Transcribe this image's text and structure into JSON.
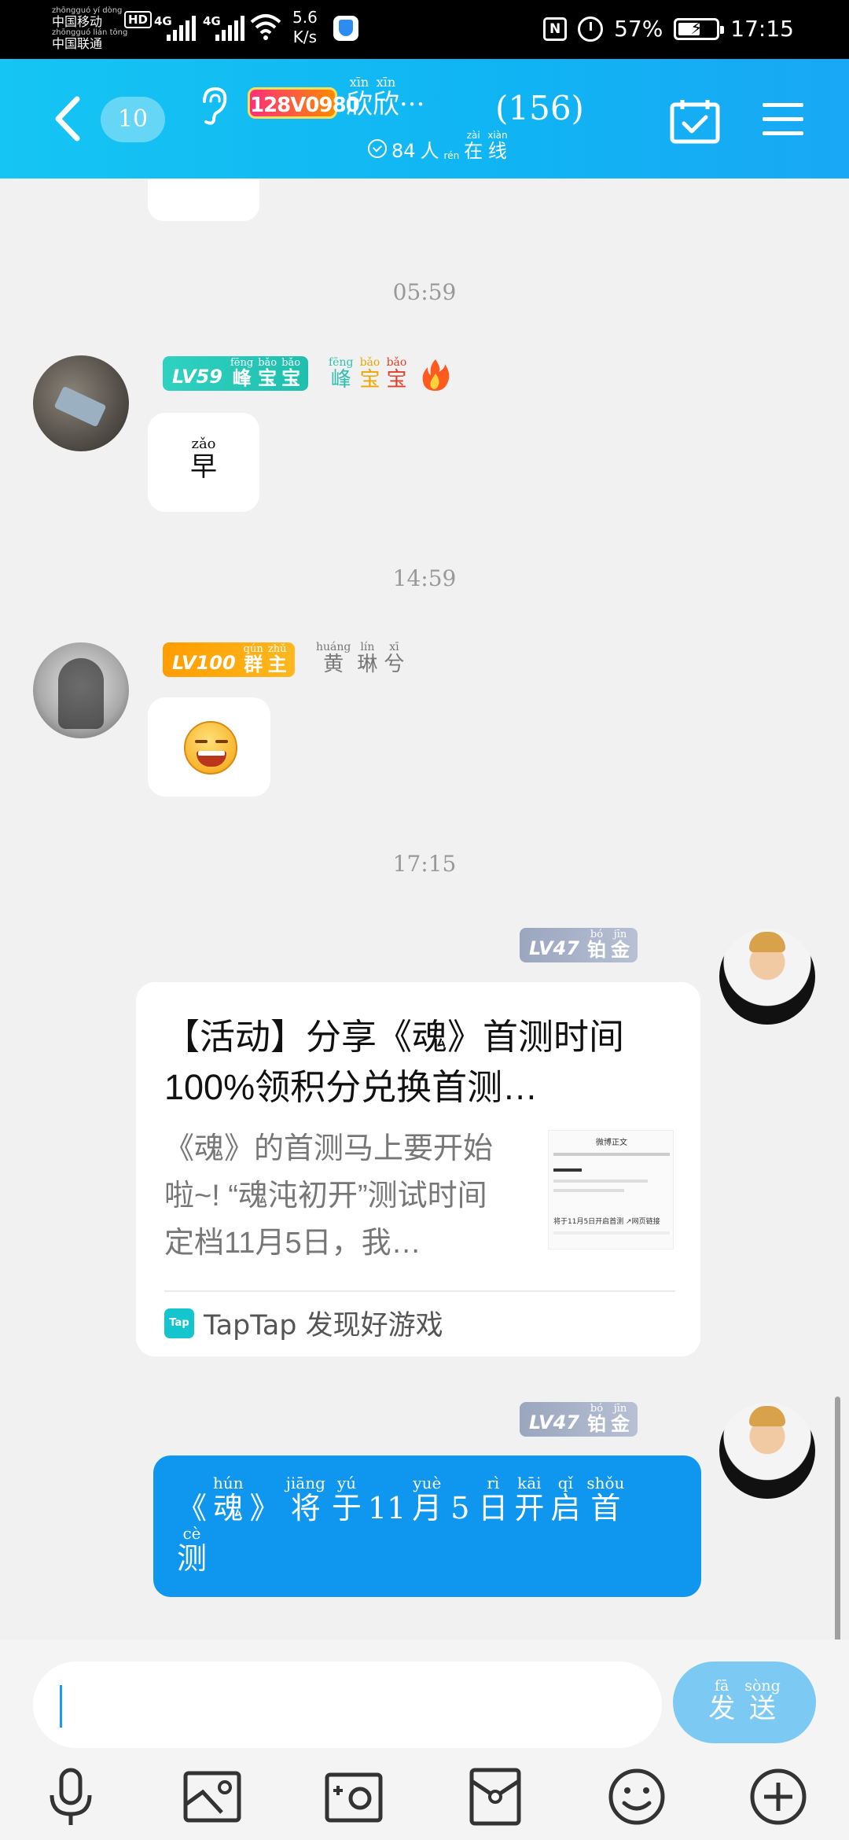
{
  "status_bar": {
    "carrier_1_pinyin": "zhōngguó yí dòng",
    "carrier_1": "中国移动",
    "carrier_2_pinyin": "zhōngguó lián tōng",
    "carrier_2": "中国联通",
    "hd": "HD",
    "network_1": "4G",
    "network_2": "4G",
    "speed_value": "5.6",
    "speed_unit": "K/s",
    "nfc": "N",
    "battery_percent": "57%",
    "battery_level": 0.57,
    "time": "17:15"
  },
  "header": {
    "unread_count": "10",
    "group_logo": "128V0980",
    "group_name": [
      {
        "py": "xīn",
        "hz": "欣"
      },
      {
        "py": "xīn",
        "hz": "欣"
      },
      {
        "py": "",
        "hz": "···"
      }
    ],
    "member_count": "(156)",
    "online_count": "84",
    "online_text": [
      {
        "py": "",
        "hz": "人"
      },
      {
        "py": "rén",
        "hz": ""
      },
      {
        "py": "zài",
        "hz": "在"
      },
      {
        "py": "xiàn",
        "hz": "线"
      }
    ]
  },
  "messages": {
    "ts1": "05:59",
    "ts2": "14:59",
    "ts3": "17:15",
    "m1": {
      "level": "LV59",
      "rank": [
        {
          "py": "fēng",
          "hz": "峰"
        },
        {
          "py": "bǎo",
          "hz": "宝"
        },
        {
          "py": "bǎo",
          "hz": "宝"
        }
      ],
      "nick": [
        {
          "py": "fēng",
          "hz": "峰"
        },
        {
          "py": "bǎo",
          "hz": "宝"
        },
        {
          "py": "bǎo",
          "hz": "宝"
        }
      ],
      "text_py": "zǎo",
      "text": "早"
    },
    "m2": {
      "level": "LV100",
      "rank": [
        {
          "py": "qún",
          "hz": "群"
        },
        {
          "py": "zhǔ",
          "hz": "主"
        }
      ],
      "nick": [
        {
          "py": "huáng",
          "hz": "黄"
        },
        {
          "py": "lín",
          "hz": "琳"
        },
        {
          "py": "xī",
          "hz": "兮"
        }
      ]
    },
    "m3": {
      "level": "LV47",
      "rank": [
        {
          "py": "bó",
          "hz": "铂"
        },
        {
          "py": "jīn",
          "hz": "金"
        }
      ],
      "card_title": "【活动】分享《魂》首测时间 100%领积分兑换首测…",
      "card_desc": "《魂》的首测马上要开始啦~! “魂沌初开”测试时间定档11月5日，我…",
      "thumb_title": "微博正文",
      "thumb_text": "将于11月5日开启首测 ↗网页链接",
      "source_logo": "Tap",
      "source": "TapTap 发现好游戏"
    },
    "m4": {
      "level": "LV47",
      "rank": [
        {
          "py": "bó",
          "hz": "铂"
        },
        {
          "py": "jīn",
          "hz": "金"
        }
      ],
      "line1": [
        {
          "py": "",
          "hz": "《"
        },
        {
          "py": "hún",
          "hz": "魂"
        },
        {
          "py": "",
          "hz": "》"
        },
        {
          "py": "jiāng",
          "hz": "将"
        },
        {
          "py": "yú",
          "hz": "于"
        },
        {
          "py": "",
          "hz": "11"
        },
        {
          "py": "yuè",
          "hz": "月"
        },
        {
          "py": "",
          "hz": "5"
        },
        {
          "py": "rì",
          "hz": "日"
        },
        {
          "py": "kāi",
          "hz": "开"
        },
        {
          "py": "qǐ",
          "hz": "启"
        },
        {
          "py": "shǒu",
          "hz": "首"
        }
      ],
      "line2": [
        {
          "py": "cè",
          "hz": "测"
        }
      ]
    }
  },
  "input": {
    "value": "",
    "send_label_py": [
      "fā",
      "sòng"
    ],
    "send_label": [
      "发",
      "送"
    ]
  },
  "toolbar": [
    "microphone-icon",
    "image-icon",
    "camera-icon",
    "red-packet-icon",
    "emoji-icon",
    "plus-icon"
  ],
  "colors": {
    "header_gradient_start": "#15c5f3",
    "header_gradient_end": "#19a8f5",
    "send_bubble": "#0f97f0",
    "send_button": "#7ccaf4",
    "lv59": "#2fd1c1",
    "lv100": "#ff9d00",
    "lv47": "#9aa6bf"
  }
}
